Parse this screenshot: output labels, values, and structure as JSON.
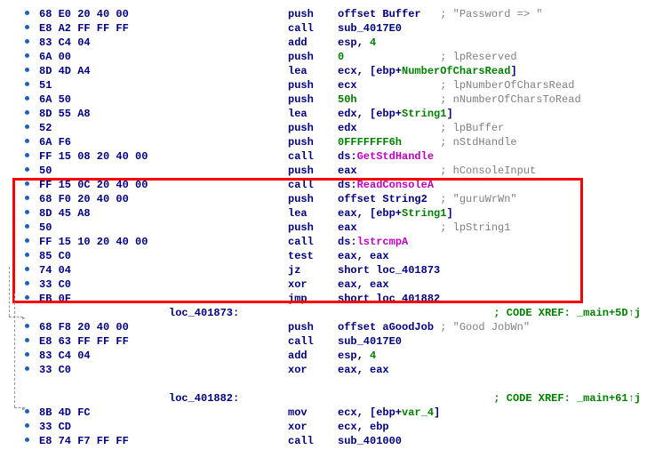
{
  "rows": [
    {
      "g": "dot",
      "hex": "68 E0 20 40 00",
      "m": "push",
      "o": [
        {
          "t": "offset Buffer   ",
          "c": "navy"
        },
        {
          "t": "; \"Password => \"",
          "c": "gray"
        }
      ]
    },
    {
      "g": "dot",
      "hex": "E8 A2 FF FF FF",
      "m": "call",
      "o": [
        {
          "t": "sub_4017E0",
          "c": "navy"
        }
      ]
    },
    {
      "g": "dot",
      "hex": "83 C4 04",
      "m": "add",
      "o": [
        {
          "t": "esp, ",
          "c": "navy"
        },
        {
          "t": "4",
          "c": "green"
        }
      ]
    },
    {
      "g": "dot",
      "hex": "6A 00",
      "m": "push",
      "o": [
        {
          "t": "0               ",
          "c": "green"
        },
        {
          "t": "; lpReserved",
          "c": "gray"
        }
      ]
    },
    {
      "g": "dot",
      "hex": "8D 4D A4",
      "m": "lea",
      "o": [
        {
          "t": "ecx, [ebp+",
          "c": "navy"
        },
        {
          "t": "NumberOfCharsRead",
          "c": "green"
        },
        {
          "t": "]",
          "c": "navy"
        }
      ]
    },
    {
      "g": "dot",
      "hex": "51",
      "m": "push",
      "o": [
        {
          "t": "ecx             ",
          "c": "navy"
        },
        {
          "t": "; lpNumberOfCharsRead",
          "c": "gray"
        }
      ]
    },
    {
      "g": "dot",
      "hex": "6A 50",
      "m": "push",
      "o": [
        {
          "t": "50h             ",
          "c": "green"
        },
        {
          "t": "; nNumberOfCharsToRead",
          "c": "gray"
        }
      ]
    },
    {
      "g": "dot",
      "hex": "8D 55 A8",
      "m": "lea",
      "o": [
        {
          "t": "edx, [ebp+",
          "c": "navy"
        },
        {
          "t": "String1",
          "c": "green"
        },
        {
          "t": "]",
          "c": "navy"
        }
      ]
    },
    {
      "g": "dot",
      "hex": "52",
      "m": "push",
      "o": [
        {
          "t": "edx             ",
          "c": "navy"
        },
        {
          "t": "; lpBuffer",
          "c": "gray"
        }
      ]
    },
    {
      "g": "dot",
      "hex": "6A F6",
      "m": "push",
      "o": [
        {
          "t": "0FFFFFFF6h      ",
          "c": "green"
        },
        {
          "t": "; nStdHandle",
          "c": "gray"
        }
      ]
    },
    {
      "g": "dot",
      "hex": "FF 15 08 20 40 00",
      "m": "call",
      "o": [
        {
          "t": "ds:",
          "c": "navy"
        },
        {
          "t": "GetStdHandle",
          "c": "mag"
        }
      ]
    },
    {
      "g": "dot",
      "hex": "50",
      "m": "push",
      "o": [
        {
          "t": "eax             ",
          "c": "navy"
        },
        {
          "t": "; hConsoleInput",
          "c": "gray"
        }
      ]
    },
    {
      "g": "dot",
      "hex": "FF 15 0C 20 40 00",
      "m": "call",
      "o": [
        {
          "t": "ds:",
          "c": "navy"
        },
        {
          "t": "ReadConsoleA",
          "c": "mag"
        }
      ]
    },
    {
      "g": "dot",
      "hex": "68 F0 20 40 00",
      "m": "push",
      "o": [
        {
          "t": "offset String2  ",
          "c": "navy"
        },
        {
          "t": "; \"guruWrWn\"",
          "c": "gray"
        }
      ]
    },
    {
      "g": "dot",
      "hex": "8D 45 A8",
      "m": "lea",
      "o": [
        {
          "t": "eax, [ebp+",
          "c": "navy"
        },
        {
          "t": "String1",
          "c": "green"
        },
        {
          "t": "]",
          "c": "navy"
        }
      ]
    },
    {
      "g": "dot",
      "hex": "50",
      "m": "push",
      "o": [
        {
          "t": "eax             ",
          "c": "navy"
        },
        {
          "t": "; lpString1",
          "c": "gray"
        }
      ]
    },
    {
      "g": "dot",
      "hex": "FF 15 10 20 40 00",
      "m": "call",
      "o": [
        {
          "t": "ds:",
          "c": "navy"
        },
        {
          "t": "lstrcmpA",
          "c": "mag"
        }
      ]
    },
    {
      "g": "dot",
      "hex": "85 C0",
      "m": "test",
      "o": [
        {
          "t": "eax, eax",
          "c": "navy"
        }
      ]
    },
    {
      "g": "dot",
      "hex": "74 04",
      "m": "jz",
      "o": [
        {
          "t": "short loc_401873",
          "c": "navy"
        }
      ]
    },
    {
      "g": "dot",
      "hex": "33 C0",
      "m": "xor",
      "o": [
        {
          "t": "eax, eax",
          "c": "navy"
        }
      ]
    },
    {
      "g": "dot",
      "hex": "EB 0F",
      "m": "jmp",
      "o": [
        {
          "t": "short loc_401882",
          "c": "navy"
        }
      ]
    }
  ],
  "label1": {
    "name": "loc_401873:",
    "xref": "; CODE XREF: _main+5D↑j"
  },
  "rows2": [
    {
      "g": "dot",
      "hex": "68 F8 20 40 00",
      "m": "push",
      "o": [
        {
          "t": "offset aGoodJob ",
          "c": "navy"
        },
        {
          "t": "; \"Good JobWn\"",
          "c": "gray"
        }
      ]
    },
    {
      "g": "dot",
      "hex": "E8 63 FF FF FF",
      "m": "call",
      "o": [
        {
          "t": "sub_4017E0",
          "c": "navy"
        }
      ]
    },
    {
      "g": "dot",
      "hex": "83 C4 04",
      "m": "add",
      "o": [
        {
          "t": "esp, ",
          "c": "navy"
        },
        {
          "t": "4",
          "c": "green"
        }
      ]
    },
    {
      "g": "dot",
      "hex": "33 C0",
      "m": "xor",
      "o": [
        {
          "t": "eax, eax",
          "c": "navy"
        }
      ]
    }
  ],
  "blank": {
    "name": "",
    "xref": ""
  },
  "label2": {
    "name": "loc_401882:",
    "xref": "; CODE XREF: _main+61↑j"
  },
  "rows3": [
    {
      "g": "dot",
      "hex": "8B 4D FC",
      "m": "mov",
      "o": [
        {
          "t": "ecx, [ebp+",
          "c": "navy"
        },
        {
          "t": "var_4",
          "c": "green"
        },
        {
          "t": "]",
          "c": "navy"
        }
      ]
    },
    {
      "g": "dot",
      "hex": "33 CD",
      "m": "xor",
      "o": [
        {
          "t": "ecx, ebp",
          "c": "navy"
        }
      ]
    },
    {
      "g": "dot",
      "hex": "E8 74 F7 FF FF",
      "m": "call",
      "o": [
        {
          "t": "sub_401000",
          "c": "navy"
        }
      ]
    }
  ]
}
